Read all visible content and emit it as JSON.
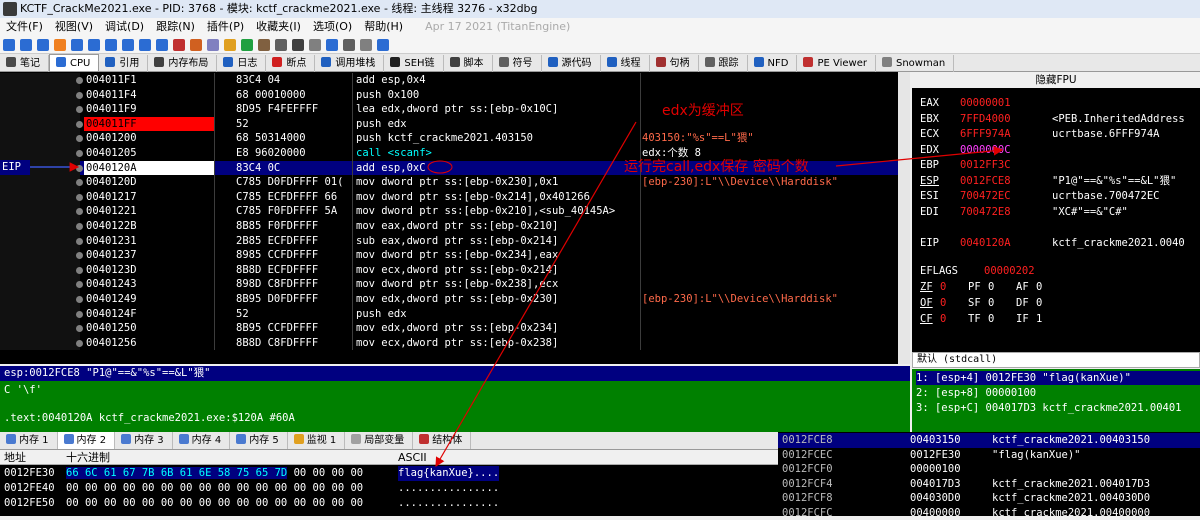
{
  "window": {
    "title": "KCTF_CrackMe2021.exe - PID: 3768 - 模块: kctf_crackme2021.exe - 线程: 主线程 3276 - x32dbg"
  },
  "menu": {
    "items": [
      "文件(F)",
      "视图(V)",
      "调试(D)",
      "跟踪(N)",
      "插件(P)",
      "收藏夹(I)",
      "选项(O)",
      "帮助(H)"
    ],
    "date": "Apr 17 2021 (TitanEngine)"
  },
  "tabs": [
    "笔记",
    "CPU",
    "引用",
    "内存布局",
    "日志",
    "断点",
    "调用堆栈",
    "SEH链",
    "脚本",
    "符号",
    "源代码",
    "线程",
    "句柄",
    "跟踪",
    "NFD",
    "PE Viewer",
    "Snowman"
  ],
  "disasm": {
    "eip_label": "EIP",
    "rows": [
      {
        "addr": "004011F1",
        "bytes": "83C4 04",
        "instr": "add esp,0x4",
        "cmt": ""
      },
      {
        "addr": "004011F4",
        "bytes": "68 00010000",
        "instr": "push 0x100",
        "cmt": ""
      },
      {
        "addr": "004011F9",
        "bytes": "8D95 F4FEFFFF",
        "instr": "lea edx,dword ptr ss:[ebp-0x10C]",
        "cmt": ""
      },
      {
        "addr": "004011FF",
        "bytes": "52",
        "instr": "push edx",
        "cmt": ""
      },
      {
        "addr": "00401200",
        "bytes": "68 50314000",
        "instr": "push kctf_crackme2021.403150",
        "cmt": "403150:\"%s\"==L\"猥\""
      },
      {
        "addr": "00401205",
        "bytes": "E8 96020000",
        "instr": "call <scanf>",
        "cmt": "edx:个数 8"
      },
      {
        "addr": "0040120A",
        "bytes": "83C4 0C",
        "instr": "add esp,0xC",
        "cmt": ""
      },
      {
        "addr": "0040120D",
        "bytes": "C785 D0FDFFFF 01(",
        "instr": "mov dword ptr ss:[ebp-0x230],0x1",
        "cmt": "[ebp-230]:L\"\\\\Device\\\\Harddisk\""
      },
      {
        "addr": "00401217",
        "bytes": "C785 ECFDFFFF 66",
        "instr": "mov dword ptr ss:[ebp-0x214],0x401266",
        "cmt": ""
      },
      {
        "addr": "00401221",
        "bytes": "C785 F0FDFFFF 5A",
        "instr": "mov dword ptr ss:[ebp-0x210],<sub_40145A>",
        "cmt": ""
      },
      {
        "addr": "0040122B",
        "bytes": "8B85 F0FDFFFF",
        "instr": "mov eax,dword ptr ss:[ebp-0x210]",
        "cmt": ""
      },
      {
        "addr": "00401231",
        "bytes": "2B85 ECFDFFFF",
        "instr": "sub eax,dword ptr ss:[ebp-0x214]",
        "cmt": ""
      },
      {
        "addr": "00401237",
        "bytes": "8985 CCFDFFFF",
        "instr": "mov dword ptr ss:[ebp-0x234],eax",
        "cmt": ""
      },
      {
        "addr": "0040123D",
        "bytes": "8B8D ECFDFFFF",
        "instr": "mov ecx,dword ptr ss:[ebp-0x214]",
        "cmt": ""
      },
      {
        "addr": "00401243",
        "bytes": "898D C8FDFFFF",
        "instr": "mov dword ptr ss:[ebp-0x238],ecx",
        "cmt": ""
      },
      {
        "addr": "00401249",
        "bytes": "8B95 D0FDFFFF",
        "instr": "mov edx,dword ptr ss:[ebp-0x230]",
        "cmt": "[ebp-230]:L\"\\\\Device\\\\Harddisk\""
      },
      {
        "addr": "0040124F",
        "bytes": "52",
        "instr": "push edx",
        "cmt": ""
      },
      {
        "addr": "00401250",
        "bytes": "8B95 CCFDFFFF",
        "instr": "mov edx,dword ptr ss:[ebp-0x234]",
        "cmt": ""
      },
      {
        "addr": "00401256",
        "bytes": "8B8D C8FDFFFF",
        "instr": "mov ecx,dword ptr ss:[ebp-0x238]",
        "cmt": ""
      }
    ]
  },
  "annotations": {
    "edx_buffer": "edx为缓冲区",
    "after_call": "运行完call,edx保存 密码个数"
  },
  "registers": {
    "header": "隐藏FPU",
    "rows": [
      {
        "name": "EAX",
        "value": "00000001",
        "comment": ""
      },
      {
        "name": "EBX",
        "value": "7FFD4000",
        "comment": "<PEB.InheritedAddress"
      },
      {
        "name": "ECX",
        "value": "6FFF974A",
        "comment": "ucrtbase.6FFF974A"
      },
      {
        "name": "EDX",
        "value": "0000000C",
        "comment": ""
      },
      {
        "name": "EBP",
        "value": "0012FF3C",
        "comment": ""
      },
      {
        "name": "ESP",
        "value": "0012FCE8",
        "comment": "\"P1@\"==&\"%s\"==&L\"猥\""
      },
      {
        "name": "ESI",
        "value": "700472EC",
        "comment": "ucrtbase.700472EC"
      },
      {
        "name": "EDI",
        "value": "700472E8",
        "comment": "\"XC#\"==&\"C#\""
      },
      {
        "name": "EIP",
        "value": "0040120A",
        "comment": "kctf_crackme2021.0040"
      }
    ],
    "eflags_label": "EFLAGS",
    "eflags_value": "00000202",
    "flags": [
      [
        {
          "n": "ZF",
          "v": "0"
        },
        {
          "n": "PF",
          "v": "0"
        },
        {
          "n": "AF",
          "v": "0"
        }
      ],
      [
        {
          "n": "OF",
          "v": "0"
        },
        {
          "n": "SF",
          "v": "0"
        },
        {
          "n": "DF",
          "v": "0"
        }
      ],
      [
        {
          "n": "CF",
          "v": "0"
        },
        {
          "n": "TF",
          "v": "0"
        },
        {
          "n": "IF",
          "v": "1"
        }
      ]
    ],
    "callconv": "默认 (stdcall)"
  },
  "stack_args": [
    "1: [esp+4] 0012FE30 \"flag(kanXue)\"",
    "2: [esp+8] 00000100",
    "3: [esp+C] 004017D3 kctf_crackme2021.00401"
  ],
  "info": {
    "line1": "esp:0012FCE8 \"P1@\"==&\"%s\"==&L\"猥\"",
    "line2": "C '\\f'",
    "line3": ".text:0040120A kctf_crackme2021.exe:$120A #60A"
  },
  "dump": {
    "tabs": [
      "内存 1",
      "内存 2",
      "内存 3",
      "内存 4",
      "内存 5",
      "监视 1",
      "局部变量",
      "结构体"
    ],
    "col_addr": "地址",
    "col_hex": "十六进制",
    "col_ascii": "ASCII",
    "rows": [
      {
        "addr": "0012FE30",
        "hex_sel": "66 6C 61 67 7B 6B 61 6E 58 75 65 7D",
        "hex_rest": " 00 00 00 00",
        "ascii": "flag{kanXue}...."
      },
      {
        "addr": "0012FE40",
        "hex_sel": "",
        "hex_rest": "00 00 00 00 00 00 00 00 00 00 00 00 00 00 00 00",
        "ascii": "................"
      },
      {
        "addr": "0012FE50",
        "hex_sel": "",
        "hex_rest": "00 00 00 00 00 00 00 00 00 00 00 00 00 00 00 00",
        "ascii": "................"
      }
    ]
  },
  "stack": {
    "rows": [
      {
        "addr": "0012FCE8",
        "val": "00403150",
        "cmt": "kctf_crackme2021.00403150"
      },
      {
        "addr": "0012FCEC",
        "val": "0012FE30",
        "cmt": "\"flag(kanXue)\""
      },
      {
        "addr": "0012FCF0",
        "val": "00000100",
        "cmt": ""
      },
      {
        "addr": "0012FCF4",
        "val": "004017D3",
        "cmt": "kctf_crackme2021.004017D3"
      },
      {
        "addr": "0012FCF8",
        "val": "004030D0",
        "cmt": "kctf_crackme2021.004030D0"
      },
      {
        "addr": "0012FCFC",
        "val": "00400000",
        "cmt": "kctf_crackme2021.00400000"
      }
    ]
  }
}
